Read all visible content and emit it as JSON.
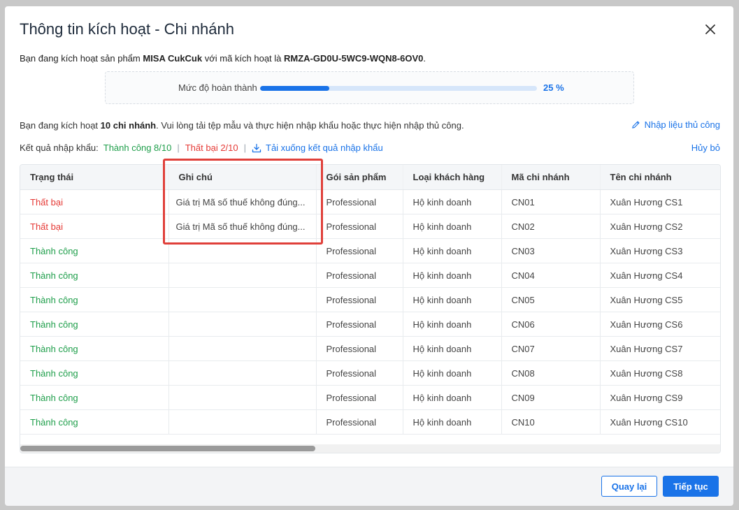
{
  "dialog": {
    "title": "Thông tin kích hoạt - Chi nhánh",
    "intro_prefix": "Bạn đang kích hoạt sản phẩm ",
    "product": "MISA CukCuk",
    "intro_mid": " với mã kích hoạt là ",
    "activation_code": "RMZA-GD0U-5WC9-WQN8-6OV0",
    "intro_suffix": "."
  },
  "progress": {
    "label": "Mức độ hoàn thành",
    "value_text": "25 %",
    "fraction": 0.25
  },
  "info": {
    "prefix": "Bạn đang kích hoạt ",
    "count": "10 chi nhánh",
    "suffix": ". Vui lòng tải tệp mẫu và thực hiện nhập khẩu hoặc thực hiện nhập thủ công.",
    "manual_label": "Nhập liệu thủ công"
  },
  "result": {
    "label": "Kết quả nhập khẩu:",
    "success": "Thành công 8/10",
    "fail": "Thất bại 2/10",
    "download_label": "Tải xuống kết quả nhập khẩu",
    "cancel_label": "Hủy bỏ"
  },
  "table": {
    "headers": [
      "Trạng thái",
      "Ghi chú",
      "Gói sản phẩm",
      "Loại khách hàng",
      "Mã chi nhánh",
      "Tên chi nhánh"
    ],
    "rows": [
      {
        "status": "Thất bại",
        "ok": false,
        "note": "Giá trị Mã số thuế không đúng...",
        "package": "Professional",
        "customer": "Hộ kinh doanh",
        "code": "CN01",
        "name": "Xuân Hương CS1"
      },
      {
        "status": "Thất bại",
        "ok": false,
        "note": "Giá trị Mã số thuế không đúng...",
        "package": "Professional",
        "customer": "Hộ kinh doanh",
        "code": "CN02",
        "name": "Xuân Hương CS2"
      },
      {
        "status": "Thành công",
        "ok": true,
        "note": "",
        "package": "Professional",
        "customer": "Hộ kinh doanh",
        "code": "CN03",
        "name": "Xuân Hương CS3"
      },
      {
        "status": "Thành công",
        "ok": true,
        "note": "",
        "package": "Professional",
        "customer": "Hộ kinh doanh",
        "code": "CN04",
        "name": "Xuân Hương CS4"
      },
      {
        "status": "Thành công",
        "ok": true,
        "note": "",
        "package": "Professional",
        "customer": "Hộ kinh doanh",
        "code": "CN05",
        "name": "Xuân Hương CS5"
      },
      {
        "status": "Thành công",
        "ok": true,
        "note": "",
        "package": "Professional",
        "customer": "Hộ kinh doanh",
        "code": "CN06",
        "name": "Xuân Hương CS6"
      },
      {
        "status": "Thành công",
        "ok": true,
        "note": "",
        "package": "Professional",
        "customer": "Hộ kinh doanh",
        "code": "CN07",
        "name": "Xuân Hương CS7"
      },
      {
        "status": "Thành công",
        "ok": true,
        "note": "",
        "package": "Professional",
        "customer": "Hộ kinh doanh",
        "code": "CN08",
        "name": "Xuân Hương CS8"
      },
      {
        "status": "Thành công",
        "ok": true,
        "note": "",
        "package": "Professional",
        "customer": "Hộ kinh doanh",
        "code": "CN09",
        "name": "Xuân Hương CS9"
      },
      {
        "status": "Thành công",
        "ok": true,
        "note": "",
        "package": "Professional",
        "customer": "Hộ kinh doanh",
        "code": "CN10",
        "name": "Xuân Hương CS10"
      }
    ]
  },
  "footer": {
    "back_label": "Quay lại",
    "next_label": "Tiếp tục"
  },
  "colors": {
    "accent": "#1a73e8",
    "success": "#1e9e4a",
    "fail": "#e53935",
    "highlight": "#e0403a"
  },
  "icons": {
    "close": "close-icon",
    "manual": "pencil-icon",
    "download": "download-icon"
  }
}
